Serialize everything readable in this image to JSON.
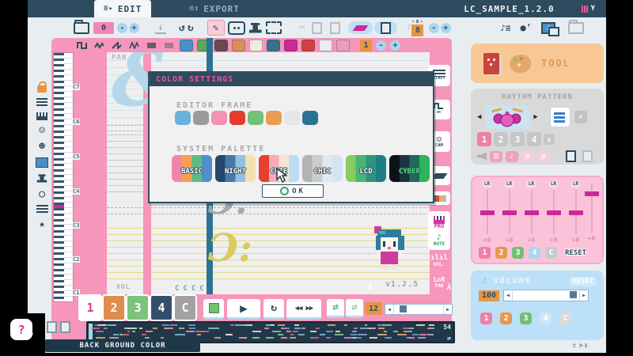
{
  "colors": {
    "navy": "#2d4a5e",
    "frame_pink": "#f596ba",
    "accent_magenta": "#cc2898",
    "panel_peach": "#f8c894",
    "panel_gray": "#d9d9d9",
    "panel_pink": "#fbc3da",
    "panel_blue": "#bce0f8",
    "timeline_navy": "#22384a"
  },
  "titlebar": {
    "tab_edit": "EDIT",
    "tab_export": "EXPORT",
    "title": "LC_SAMPLE_1.2.0"
  },
  "toolbar": {
    "page_value": "0",
    "minus": "-",
    "plus": "+",
    "grid_prefix": "-x-",
    "grid_value": "8"
  },
  "instruments": {
    "counter_value": "1"
  },
  "dialog": {
    "title": "COLOR SETTINGS",
    "editor_frame_label": "EDITOR FRAME",
    "frame_swatches": [
      "#6ab1dd",
      "#9b9b9b",
      "#f492b2",
      "#e43c2b",
      "#74c278",
      "#ea9c52",
      "#e6e6e6",
      "#2c7294"
    ],
    "system_palette_label": "SYSTEM PALETTE",
    "ok_label": "OK",
    "palettes": [
      {
        "label": "BASIC",
        "stripes": [
          "#f483ac",
          "#f7a051",
          "#5cbd7e",
          "#4f8fcc"
        ],
        "text": "#ffffff"
      },
      {
        "label": "NIGHT",
        "stripes": [
          "#27456a",
          "#4879ab",
          "#93c1e0",
          "#f2e2ae"
        ],
        "text": "#ffffff"
      },
      {
        "label": "CUTE",
        "stripes": [
          "#e6402f",
          "#f6aabc",
          "#f9e3d2",
          "#bcdcf2"
        ],
        "text": "#ffffff"
      },
      {
        "label": "CHIC",
        "stripes": [
          "#b3b3b3",
          "#cccccc",
          "#e2e9ee",
          "#d3e5f2"
        ],
        "text": "#ffffff"
      },
      {
        "label": "LCD",
        "stripes": [
          "#86cc5e",
          "#47b575",
          "#2d9579",
          "#1f7d85"
        ],
        "text": "#ffffff"
      },
      {
        "label": "CYBER",
        "stripes": [
          "#0c1318",
          "#1d3140",
          "#1f6a59",
          "#2db45e"
        ],
        "text": "#4ad878"
      }
    ]
  },
  "editor": {
    "pan_label": "PAN",
    "vol_label": "VOL",
    "measure_number": "1",
    "chord_row": "CCCC",
    "octaves": [
      "C7",
      "C6",
      "C5",
      "C4",
      "C3",
      "C2",
      "C1"
    ],
    "version": "v1.2.5"
  },
  "side_buttons": {
    "staff": "STAFF",
    "cam": "CAM",
    "pro": "PRO",
    "note": "NOTE",
    "vol": "VOL.",
    "pan": "PAN"
  },
  "transport": {
    "tracks": [
      "1",
      "2",
      "3",
      "4",
      "C"
    ],
    "tempo_value": "12",
    "timeline_length": "54"
  },
  "footer": {
    "label": "BACK GROUND COLOR",
    "help": "?"
  },
  "sidebar": {
    "tool": {
      "label": "TOOL"
    },
    "rhythm": {
      "label": "RHYTHM PATTERN",
      "slots": [
        "1",
        "2",
        "3",
        "4",
        "x"
      ]
    },
    "pan": {
      "channel_label": "LR",
      "values": [
        "+0",
        "+0",
        "+0",
        "+0",
        "+0"
      ],
      "master_value": "+0",
      "buttons": [
        "1",
        "2",
        "3",
        "4",
        "C"
      ],
      "reset_label": "RESET"
    },
    "volume": {
      "label": "VOLUME",
      "reset_label": "RESET",
      "value": "100",
      "buttons": [
        "1",
        "2",
        "3",
        "4",
        "C"
      ]
    }
  }
}
